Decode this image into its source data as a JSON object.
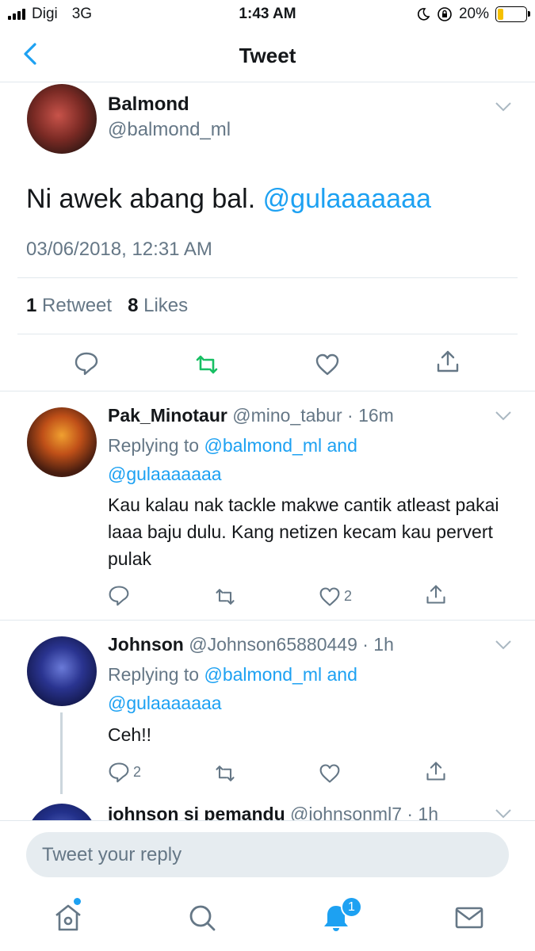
{
  "status_bar": {
    "carrier": "Digi",
    "network": "3G",
    "time": "1:43 AM",
    "battery": "20%",
    "battery_level": 0.2
  },
  "header": {
    "title": "Tweet"
  },
  "main_tweet": {
    "name": "Balmond",
    "handle": "@balmond_ml",
    "text": "Ni awek abang bal.",
    "mention": "@gulaaaaaaa",
    "date": "03/06/2018, 12:31 AM",
    "retweet_count": "1",
    "retweet_label": "Retweet",
    "like_count": "8",
    "like_label": "Likes"
  },
  "replies": [
    {
      "name": "Pak_Minotaur",
      "meta": "@mino_tabur · 16m",
      "replying_prefix": "Replying to",
      "replying_users": "@balmond_ml and",
      "replying_users2": "@gulaaaaaaa",
      "text": "Kau kalau nak tackle makwe cantik atleast pakai laaa baju dulu. Kang netizen kecam kau pervert pulak",
      "reply_count": "",
      "like_count": "2"
    },
    {
      "name": "Johnson",
      "meta": "@Johnson65880449 · 1h",
      "replying_prefix": "Replying to",
      "replying_users": "@balmond_ml and",
      "replying_users2": "@gulaaaaaaa",
      "text": "Ceh!!",
      "reply_count": "2",
      "like_count": ""
    },
    {
      "name": "johnson si pemandu",
      "meta": "@johnsonml7 · 1h"
    }
  ],
  "composer": {
    "placeholder": "Tweet your reply"
  },
  "tab_bar": {
    "notification_count": "1"
  },
  "colors": {
    "accent": "#1da1f2",
    "retweet_green": "#17bf63",
    "muted": "#657786"
  }
}
